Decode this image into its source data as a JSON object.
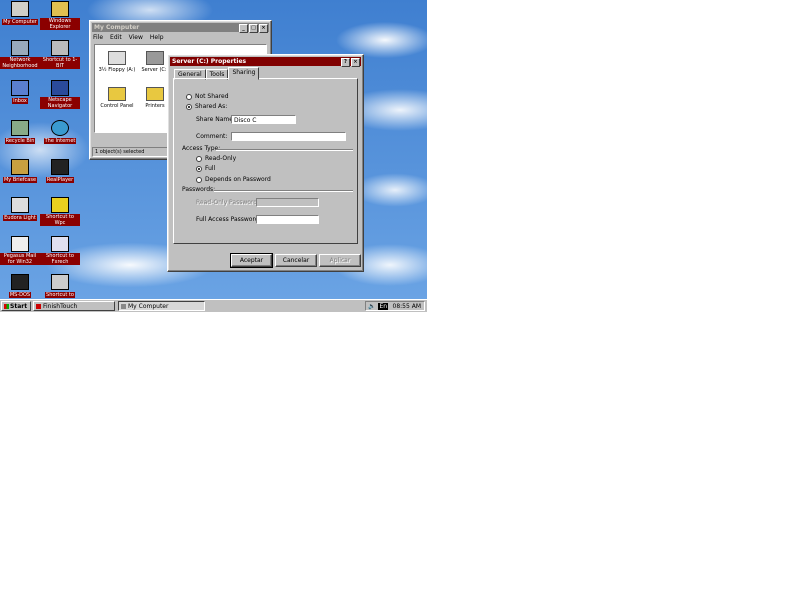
{
  "desktop_icons": [
    {
      "label": "My Computer",
      "icon": "my-computer-icon"
    },
    {
      "label": "Windows Explorer",
      "icon": "windows-explorer-icon"
    },
    {
      "label": "Network Neighborhood",
      "icon": "network-neighborhood-icon"
    },
    {
      "label": "Shortcut to 1-BIT",
      "icon": "shortcut-icon"
    },
    {
      "label": "Inbox",
      "icon": "inbox-icon"
    },
    {
      "label": "Netscape Navigator",
      "icon": "netscape-icon"
    },
    {
      "label": "Recycle Bin",
      "icon": "recycle-bin-icon"
    },
    {
      "label": "The Internet",
      "icon": "internet-icon"
    },
    {
      "label": "My Briefcase",
      "icon": "briefcase-icon"
    },
    {
      "label": "RealPlayer",
      "icon": "realplayer-icon"
    },
    {
      "label": "Eudora Light",
      "icon": "eudora-icon"
    },
    {
      "label": "Shortcut to Wpc",
      "icon": "shortcut-icon"
    },
    {
      "label": "Pegasus Mail for Win32",
      "icon": "pegasus-icon"
    },
    {
      "label": "Shortcut to Fxrech",
      "icon": "shortcut-icon"
    },
    {
      "label": "MS-DOS",
      "icon": "msdos-icon"
    },
    {
      "label": "Shortcut to",
      "icon": "shortcut-icon"
    }
  ],
  "explorer": {
    "title": "My Computer",
    "menu": [
      "File",
      "Edit",
      "View",
      "Help"
    ],
    "items": [
      {
        "label": "3½ Floppy (A:)",
        "icon": "floppy-icon"
      },
      {
        "label": "Server (C:)",
        "icon": "drive-icon"
      },
      {
        "label": "Control Panel",
        "icon": "control-panel-icon"
      },
      {
        "label": "Printers",
        "icon": "printers-icon"
      }
    ],
    "status": "1 object(s) selected"
  },
  "dialog": {
    "title": "Server (C:) Properties",
    "tabs": [
      "General",
      "Tools",
      "Sharing"
    ],
    "selected_tab": "Sharing",
    "not_shared_label": "Not Shared",
    "shared_as_label": "Shared As:",
    "share_name_label": "Share Name:",
    "share_name_value": "Disco C",
    "comment_label": "Comment:",
    "comment_value": "",
    "access_type_label": "Access Type:",
    "read_only_label": "Read-Only",
    "full_label": "Full",
    "depends_label": "Depends on Password",
    "passwords_label": "Passwords:",
    "read_only_password_label": "Read-Only Password:",
    "full_access_password_label": "Full Access Password:",
    "ok_label": "Aceptar",
    "cancel_label": "Cancelar",
    "apply_label": "Aplicar"
  },
  "taskbar": {
    "start_label": "Start",
    "items": [
      "FinishTouch",
      "My Computer"
    ],
    "active_item": "My Computer",
    "tray_lang": "En",
    "clock": "08:55 AM"
  },
  "colors": {
    "active_title": "#800000",
    "inactive_title": "#808080",
    "desktop_label_bg": "#8b0000",
    "face": "#c0c0c0"
  }
}
